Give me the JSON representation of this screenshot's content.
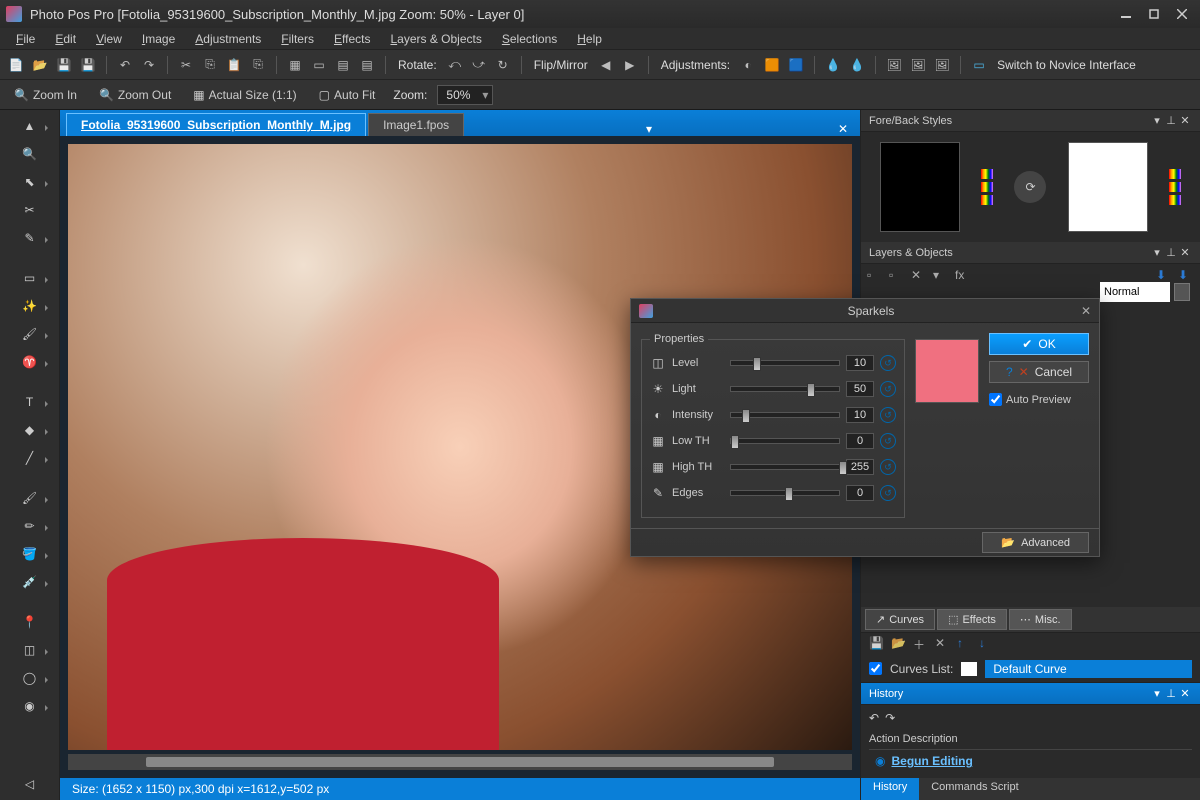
{
  "titlebar": {
    "app": "Photo Pos Pro",
    "document": "[Fotolia_95319600_Subscription_Monthly_M.jpg Zoom: 50% - Layer 0]"
  },
  "menus": [
    "File",
    "Edit",
    "View",
    "Image",
    "Adjustments",
    "Filters",
    "Effects",
    "Layers & Objects",
    "Selections",
    "Help"
  ],
  "toolbar1": {
    "rotate": "Rotate:",
    "flip": "Flip/Mirror",
    "adjustments": "Adjustments:",
    "novice": "Switch to Novice Interface"
  },
  "toolbar2": {
    "zoomIn": "Zoom In",
    "zoomOut": "Zoom Out",
    "actual": "Actual Size (1:1)",
    "autofit": "Auto Fit",
    "zoomLabel": "Zoom:",
    "zoomValue": "50%"
  },
  "tabs": {
    "active": "Fotolia_95319600_Subscription_Monthly_M.jpg",
    "inactive": "Image1.fpos"
  },
  "status": "Size: (1652 x 1150) px,300 dpi   x=1612,y=502 px",
  "panels": {
    "forebkg": "Fore/Back Styles",
    "layers": "Layers & Objects",
    "blend": "Normal",
    "subtabs": {
      "curves": "Curves",
      "effects": "Effects",
      "misc": "Misc."
    },
    "curvesListLabel": "Curves List:",
    "curveName": "Default Curve",
    "history": "History",
    "historyCols": "Action Description",
    "historyItem": "Begun Editing",
    "historyTabs": {
      "history": "History",
      "cmd": "Commands Script"
    }
  },
  "dialog": {
    "title": "Sparkels",
    "groupLabel": "Properties",
    "rows": [
      {
        "icon": "level-icon",
        "label": "Level",
        "value": "10",
        "pos": 20
      },
      {
        "icon": "light-icon",
        "label": "Light",
        "value": "50",
        "pos": 70
      },
      {
        "icon": "intensity-icon",
        "label": "Intensity",
        "value": "10",
        "pos": 10
      },
      {
        "icon": "lowth-icon",
        "label": "Low TH",
        "value": "0",
        "pos": 0
      },
      {
        "icon": "highth-icon",
        "label": "High TH",
        "value": "255",
        "pos": 100
      },
      {
        "icon": "edges-icon",
        "label": "Edges",
        "value": "0",
        "pos": 50
      }
    ],
    "ok": "OK",
    "cancel": "Cancel",
    "autoPreview": "Auto Preview",
    "advanced": "Advanced"
  }
}
